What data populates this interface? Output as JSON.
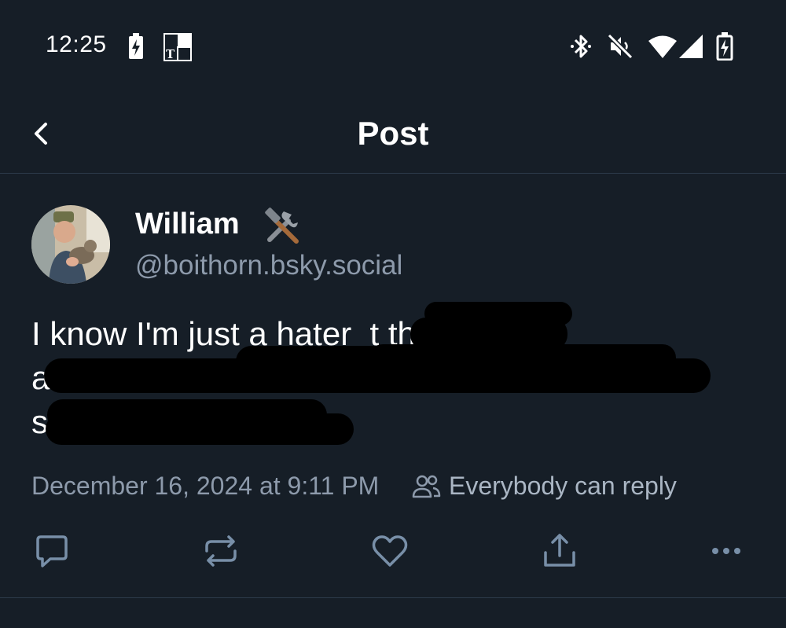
{
  "status_bar": {
    "time": "12:25",
    "left_icons": [
      "battery-saver-icon",
      "nyt-app-icon"
    ],
    "right_icons": [
      "bluetooth-icon",
      "muted-icon",
      "wifi-icon",
      "cell-signal-icon",
      "battery-charging-icon"
    ]
  },
  "header": {
    "title": "Post",
    "back_icon": "chevron-left-icon"
  },
  "post": {
    "author": {
      "display_name": "William",
      "name_emoji": "hammer-and-wrench-icon",
      "handle": "@boithorn.bsky.social"
    },
    "text": "I know I'm just a hater  t the\nab  nd\ns",
    "text_redacted": true,
    "timestamp": "December 16, 2024 at 9:11 PM",
    "reply_setting": "Everybody can reply"
  },
  "actions": [
    {
      "name": "reply",
      "icon": "comment-icon"
    },
    {
      "name": "repost",
      "icon": "repost-icon"
    },
    {
      "name": "like",
      "icon": "heart-icon"
    },
    {
      "name": "share",
      "icon": "share-icon"
    },
    {
      "name": "more",
      "icon": "more-icon"
    }
  ],
  "colors": {
    "background": "#161e27",
    "primary_text": "#ffffff",
    "secondary_text": "#8d9aab",
    "icon": "#788fa8",
    "divider": "#2c3a49"
  }
}
